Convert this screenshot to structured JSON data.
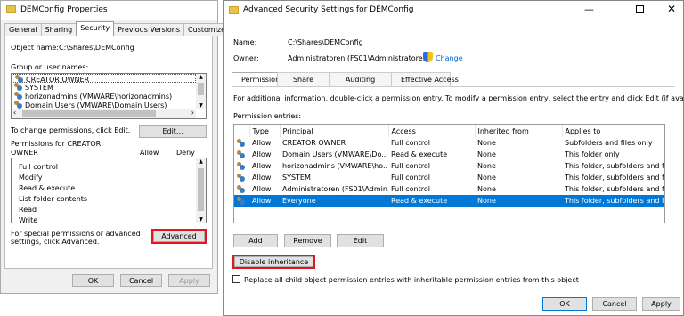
{
  "left": {
    "title": "DEMConfig Properties",
    "tabs": [
      "General",
      "Sharing",
      "Security",
      "Previous Versions",
      "Customize"
    ],
    "object_name_label": "Object name:",
    "object_name_value": "C:\\Shares\\DEMConfig",
    "group_label": "Group or user names:",
    "users": [
      "CREATOR OWNER",
      "SYSTEM",
      "horizonadmins (VMWARE\\horizonadmins)",
      "Domain Users (VMWARE\\Domain Users)"
    ],
    "change_text": "To change permissions, click Edit.",
    "edit_label": "Edit...",
    "permissions_for": "Permissions for CREATOR OWNER",
    "allow_label": "Allow",
    "deny_label": "Deny",
    "permissions": [
      "Full control",
      "Modify",
      "Read & execute",
      "List folder contents",
      "Read",
      "Write"
    ],
    "special_text": "For special permissions or advanced settings, click Advanced.",
    "advanced_label": "Advanced",
    "ok": "OK",
    "cancel": "Cancel",
    "apply": "Apply"
  },
  "right": {
    "title": "Advanced Security Settings for DEMConfig",
    "name_label": "Name:",
    "name_value": "C:\\Shares\\DEMConfig",
    "owner_label": "Owner:",
    "owner_value": "Administratoren (FS01\\Administratoren)",
    "change_link": "Change",
    "tabs": [
      "Permissions",
      "Share",
      "Auditing",
      "Effective Access"
    ],
    "info_text": "For additional information, double-click a permission entry. To modify a permission entry, select the entry and click Edit (if available).",
    "entries_label": "Permission entries:",
    "columns": [
      "Type",
      "Principal",
      "Access",
      "Inherited from",
      "Applies to"
    ],
    "rows": [
      [
        "Allow",
        "CREATOR OWNER",
        "Full control",
        "None",
        "Subfolders and files only"
      ],
      [
        "Allow",
        "Domain Users (VMWARE\\Do...",
        "Read & execute",
        "None",
        "This folder only"
      ],
      [
        "Allow",
        "horizonadmins (VMWARE\\ho...",
        "Full control",
        "None",
        "This folder, subfolders and files"
      ],
      [
        "Allow",
        "SYSTEM",
        "Full control",
        "None",
        "This folder, subfolders and files"
      ],
      [
        "Allow",
        "Administratoren (FS01\\Admin...",
        "Full control",
        "None",
        "This folder, subfolders and files"
      ],
      [
        "Allow",
        "Everyone",
        "Read & execute",
        "None",
        "This folder, subfolders and files"
      ]
    ],
    "add": "Add",
    "remove": "Remove",
    "edit": "Edit",
    "disable_inheritance": "Disable inheritance",
    "replace_text": "Replace all child object permission entries with inheritable permission entries from this object",
    "ok": "OK",
    "cancel": "Cancel",
    "apply": "Apply",
    "colors": {
      "selection": "#0078d7",
      "highlight": "#e5141f"
    }
  }
}
